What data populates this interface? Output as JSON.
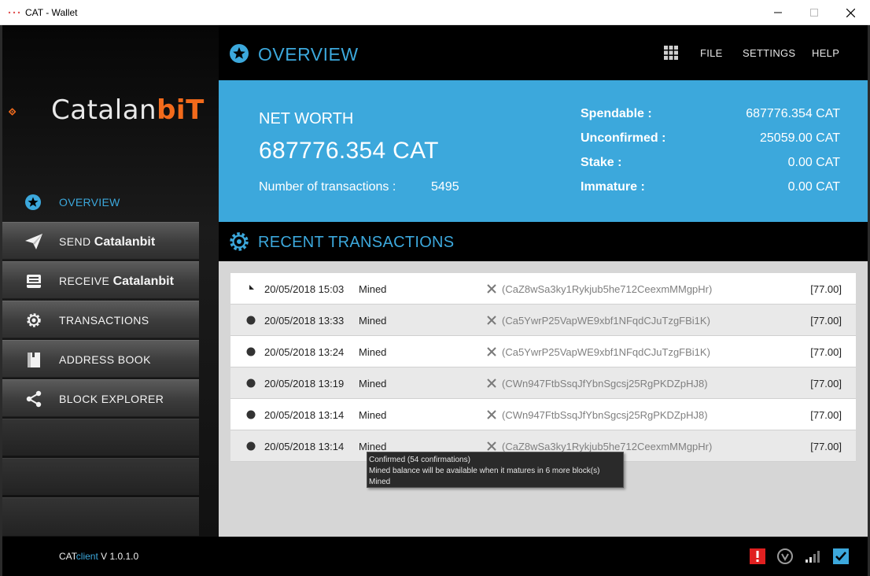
{
  "window": {
    "title": "CAT - Wallet"
  },
  "brand": {
    "logo_text_main": "Catalan",
    "logo_text_accent": "biT",
    "accent_color": "#3ca8dc",
    "logo_color": "#f26a1b"
  },
  "sidebar": {
    "overview_label": "OVERVIEW",
    "items": [
      {
        "label_plain": "SEND ",
        "label_bold": "Catalanbit",
        "icon": "send-icon"
      },
      {
        "label_plain": "RECEIVE ",
        "label_bold": "Catalanbit",
        "icon": "inbox-icon"
      },
      {
        "label_plain": "TRANSACTIONS",
        "label_bold": "",
        "icon": "gear-icon"
      },
      {
        "label_plain": "ADDRESS BOOK",
        "label_bold": "",
        "icon": "book-icon"
      },
      {
        "label_plain": "BLOCK EXPLORER",
        "label_bold": "",
        "icon": "share-icon"
      }
    ]
  },
  "header": {
    "title": "OVERVIEW",
    "menu": [
      "FILE",
      "SETTINGS",
      "HELP"
    ]
  },
  "summary": {
    "net_worth_label": "NET WORTH",
    "net_worth_value": "687776.354 CAT",
    "num_tx_label": "Number of transactions :",
    "num_tx_value": "5495",
    "balances": [
      {
        "label": "Spendable :",
        "value": "687776.354 CAT"
      },
      {
        "label": "Unconfirmed :",
        "value": "25059.00 CAT"
      },
      {
        "label": "Stake :",
        "value": "0.00 CAT"
      },
      {
        "label": "Immature :",
        "value": "0.00 CAT"
      }
    ]
  },
  "recent": {
    "title": "RECENT TRANSACTIONS",
    "rows": [
      {
        "date": "20/05/2018 15:03",
        "type": "Mined",
        "address": "(CaZ8wSa3ky1Rykjub5he712CeexmMMgpHr)",
        "amount": "[77.00]",
        "status": "pending"
      },
      {
        "date": "20/05/2018 13:33",
        "type": "Mined",
        "address": "(Ca5YwrP25VapWE9xbf1NFqdCJuTzgFBi1K)",
        "amount": "[77.00]",
        "status": "confirmed"
      },
      {
        "date": "20/05/2018 13:24",
        "type": "Mined",
        "address": "(Ca5YwrP25VapWE9xbf1NFqdCJuTzgFBi1K)",
        "amount": "[77.00]",
        "status": "confirmed"
      },
      {
        "date": "20/05/2018 13:19",
        "type": "Mined",
        "address": "(CWn947FtbSsqJfYbnSgcsj25RgPKDZpHJ8)",
        "amount": "[77.00]",
        "status": "confirmed"
      },
      {
        "date": "20/05/2018 13:14",
        "type": "Mined",
        "address": "(CWn947FtbSsqJfYbnSgcsj25RgPKDZpHJ8)",
        "amount": "[77.00]",
        "status": "confirmed"
      },
      {
        "date": "20/05/2018 13:14",
        "type": "Mined",
        "address": "(CaZ8wSa3ky1Rykjub5he712CeexmMMgpHr)",
        "amount": "[77.00]",
        "status": "confirmed"
      }
    ]
  },
  "tooltip": {
    "lines": [
      "Confirmed (54 confirmations)",
      "Mined balance will be available when it matures in 6 more block(s)",
      "Mined"
    ]
  },
  "status_bar": {
    "version_prefix": "CAT",
    "version_client": "client",
    "version_number": " V 1.0.1.0",
    "icons": [
      "warning-icon",
      "staking-icon",
      "signal-icon",
      "sync-check-icon"
    ]
  }
}
